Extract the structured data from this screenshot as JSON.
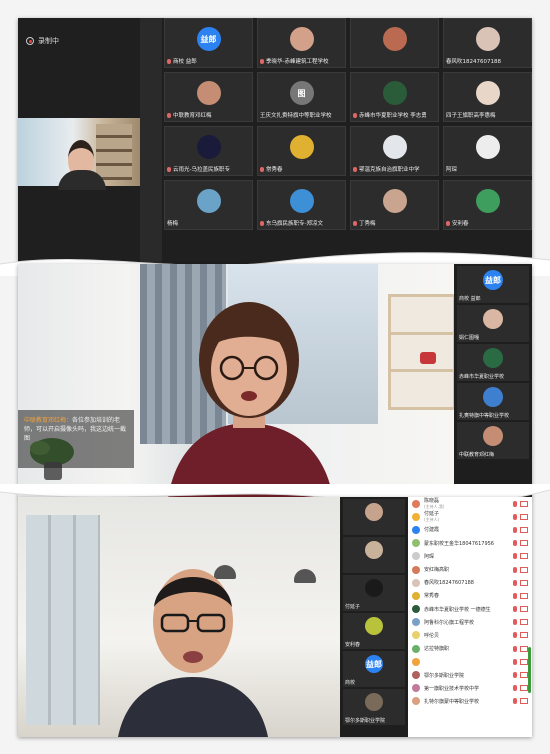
{
  "panel1": {
    "recording": "录制中",
    "tiles": [
      {
        "name": "商校 益郎",
        "avatar": "text",
        "avatar_text": "益郎",
        "color": "#2c82f0",
        "mic": true
      },
      {
        "name": "季晓华-赤峰建筑工程学校",
        "avatar": "photo",
        "color": "#d3a18a",
        "mic": true
      },
      {
        "name": "",
        "avatar": "photo",
        "color": "#b96a50",
        "mic": false
      },
      {
        "name": "春风吹18247607188",
        "avatar": "photo",
        "color": "#d8c3b6",
        "mic": false
      },
      {
        "name": "中联教育邓红梅",
        "avatar": "photo",
        "color": "#c48d74",
        "mic": true
      },
      {
        "name": "王庆文扎赉特旗中等职业学校",
        "avatar": "text",
        "avatar_text": "图",
        "color": "#777",
        "mic": false
      },
      {
        "name": "赤峰市华夏职业学校 李志勇",
        "avatar": "photo",
        "color": "#2a5c3a",
        "mic": true
      },
      {
        "name": "四子王旗职高李惠梅",
        "avatar": "photo",
        "color": "#e8d6c8",
        "mic": false
      },
      {
        "name": "云雨光-乌拉盖民族职专",
        "avatar": "photo",
        "color": "#1a1a3a",
        "mic": true
      },
      {
        "name": "常秀春",
        "avatar": "photo",
        "color": "#e0b030",
        "mic": true
      },
      {
        "name": "鄂温克族自治旗职业中学",
        "avatar": "photo",
        "color": "#e3e6ea",
        "mic": true
      },
      {
        "name": "阿琛",
        "avatar": "photo",
        "color": "#ededed",
        "mic": false
      },
      {
        "name": "杨梅",
        "avatar": "photo",
        "color": "#6aa2c8",
        "mic": false
      },
      {
        "name": "东乌旗民族职专-郑凉文",
        "avatar": "photo",
        "color": "#3d8fd6",
        "mic": true
      },
      {
        "name": "丁秀梅",
        "avatar": "photo",
        "color": "#c9a58f",
        "mic": true
      },
      {
        "name": "安利春",
        "avatar": "photo",
        "color": "#3e9e5e",
        "mic": true
      }
    ]
  },
  "panel2": {
    "subtitle_highlight": "中联教育邓红梅：",
    "subtitle_text": "各位参加培训的老师，可以开启摄像头吗，我这边统一截图",
    "side": [
      {
        "name": "商校 益郎",
        "avatar": "text",
        "avatar_text": "益郎",
        "color": "#2c82f0"
      },
      {
        "name": "娟仁图嘎",
        "avatar": "photo",
        "color": "#d9b7a2"
      },
      {
        "name": "赤峰市华夏职业学校",
        "avatar": "photo",
        "color": "#2b6b43"
      },
      {
        "name": "扎赉特旗中等职业学校",
        "avatar": "photo",
        "color": "#3f7fcf"
      },
      {
        "name": "中联教育邓红梅",
        "avatar": "photo",
        "color": "#c48d74"
      }
    ]
  },
  "panel3": {
    "side": [
      {
        "name": "",
        "avatar": "photo",
        "color": "#c6a38c"
      },
      {
        "name": "",
        "avatar": "photo",
        "color": "#c9b29a"
      },
      {
        "name": "付延子",
        "avatar": "photo",
        "color": "#1a1a1a"
      },
      {
        "name": "安利春",
        "avatar": "photo",
        "color": "#b8c23a"
      },
      {
        "name": "商校",
        "avatar": "text",
        "avatar_text": "益郎",
        "color": "#2c82f0"
      },
      {
        "name": "鄂尔多斯职业学院",
        "avatar": "photo",
        "color": "#7a6a5a"
      }
    ],
    "participants": [
      {
        "name": "陈晓磊",
        "sub": "(主持人,我)",
        "color": "#e07a5f"
      },
      {
        "name": "付延子",
        "sub": "(主持人)",
        "color": "#f2b134"
      },
      {
        "name": "付建霞",
        "sub": "",
        "color": "#2c82f0"
      },
      {
        "name": "蒙东职校王金华18047617956",
        "sub": "",
        "color": "#8fbf6f"
      },
      {
        "name": "阿琛",
        "sub": "",
        "color": "#cccccc"
      },
      {
        "name": "安红梅高职",
        "sub": "",
        "color": "#d47a5a"
      },
      {
        "name": "春风吹18247607188",
        "sub": "",
        "color": "#d8c3b6"
      },
      {
        "name": "常秀春",
        "sub": "",
        "color": "#e0b030"
      },
      {
        "name": "赤峰市华夏职业学校 一德德生",
        "sub": "",
        "color": "#2a5c3a"
      },
      {
        "name": "阿鲁科尔沁旗工程学校",
        "sub": "",
        "color": "#7aa0c8"
      },
      {
        "name": "呼伦贝",
        "sub": "",
        "color": "#e8d06a"
      },
      {
        "name": "达拉特旗职",
        "sub": "",
        "color": "#6ab06a"
      },
      {
        "name": "",
        "sub": "",
        "color": "#f2a23c"
      },
      {
        "name": "鄂尔多斯职业学院",
        "sub": "",
        "color": "#b06060"
      },
      {
        "name": "第一旗职业技术学校中学",
        "sub": "",
        "color": "#c07a9a"
      },
      {
        "name": "扎特尔旗蒙中等职业学校",
        "sub": "",
        "color": "#d8a080"
      }
    ]
  }
}
